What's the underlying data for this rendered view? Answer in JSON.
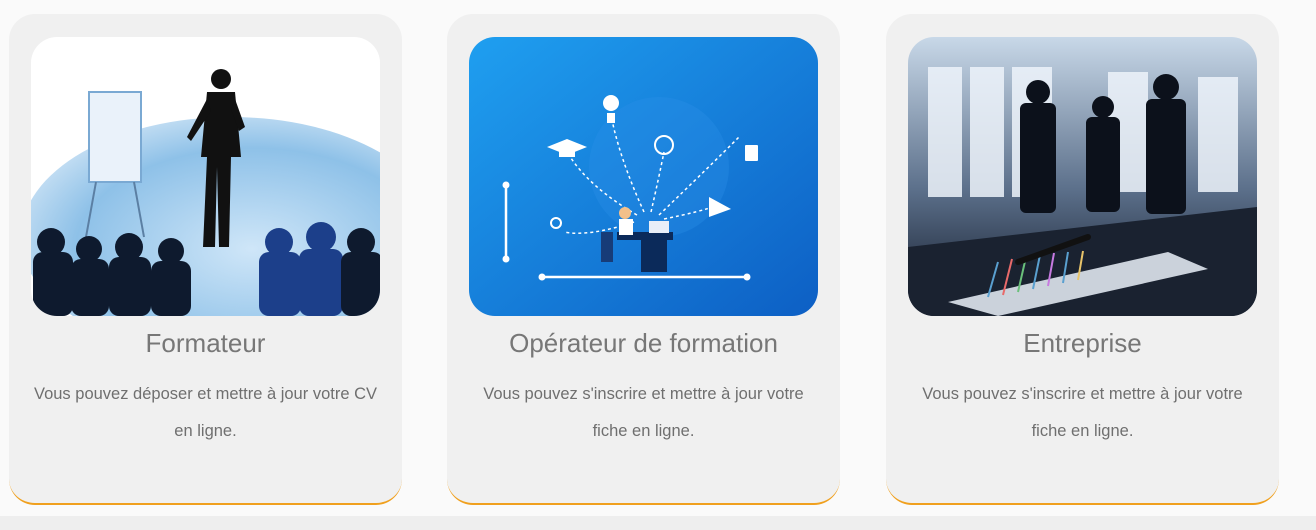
{
  "cards": [
    {
      "title": "Formateur",
      "description": "Vous pouvez déposer et mettre à jour votre CV en ligne.",
      "image": "trainer-presenting-silhouette"
    },
    {
      "title": "Opérateur de formation",
      "description": "Vous pouvez s'inscrire et mettre à jour votre fiche en ligne.",
      "image": "education-network-illustration"
    },
    {
      "title": "Entreprise",
      "description": "Vous pouvez s'inscrire et mettre à jour votre fiche en ligne.",
      "image": "business-meeting-photo"
    }
  ],
  "colors": {
    "card_background": "#f0f0f0",
    "accent_border": "#f0a01e",
    "title_text": "#777777",
    "description_text": "#6f6f6f"
  }
}
